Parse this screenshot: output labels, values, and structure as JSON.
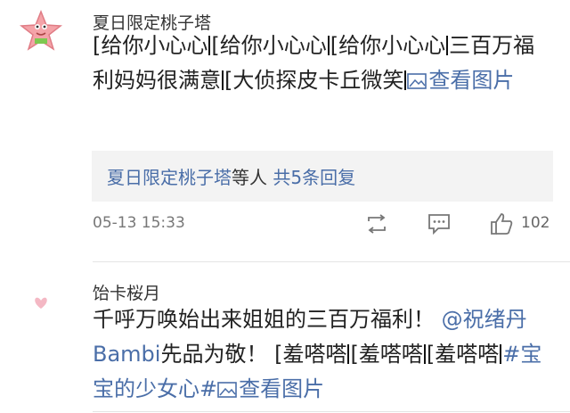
{
  "comments": [
    {
      "username": "夏日限定桃子塔",
      "segments": [
        {
          "t": "emo",
          "v": "[给你小心心"
        },
        {
          "t": "emo",
          "v": "[给你小心心"
        },
        {
          "t": "emo",
          "v": "[给你小心心"
        },
        {
          "t": "text",
          "v": "三百万福利妈妈很满意"
        },
        {
          "t": "emo",
          "v": "[大侦探皮卡丘微笑"
        },
        {
          "t": "link",
          "v": "查看图片"
        }
      ],
      "reply_preview": {
        "user": "夏日限定桃子塔",
        "middle": "等人",
        "total": "共5条回复"
      },
      "timestamp": "05-13 15:33",
      "like_count": "102"
    },
    {
      "username": "饴卡桜月",
      "line1": "千呼万唤始出来姐姐的三百万福利！",
      "mention": "@祝绪丹Bambi",
      "line2": "先品为敬！",
      "emos": [
        "[羞嗒嗒",
        "[羞嗒嗒",
        "[羞嗒嗒"
      ],
      "hashtag": "#宝宝的少女心#",
      "link": "查看图片"
    }
  ],
  "icons": {
    "avatar1": "patrick-star-avatar",
    "avatar2": "pink-heart-avatar",
    "repost": "repost-icon",
    "comment": "comment-icon",
    "like": "thumbs-up-icon",
    "picture": "picture-icon"
  },
  "colors": {
    "link": "#4a6ea8",
    "text": "#222222",
    "meta": "#777777",
    "reply_bg": "#f3f3f3"
  }
}
